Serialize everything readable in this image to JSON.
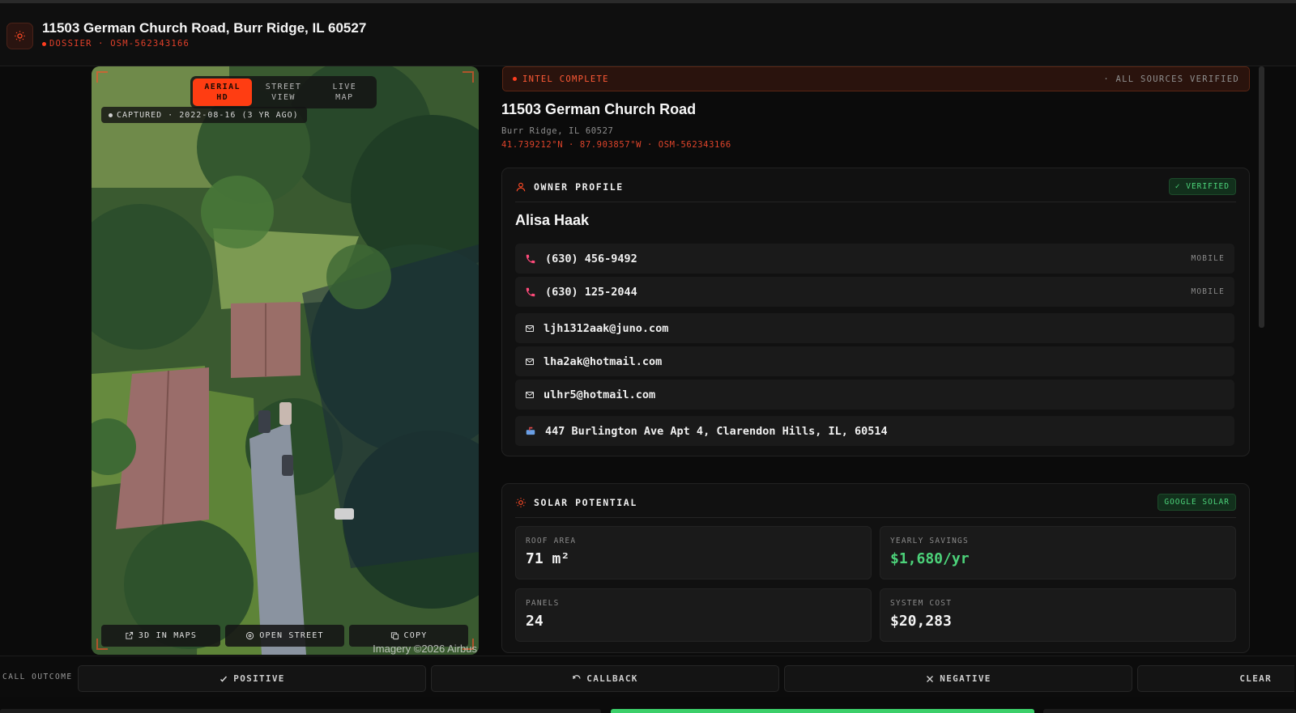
{
  "header": {
    "title": "11503 German Church Road, Burr Ridge, IL 60527",
    "subtitle": "DOSSIER · OSM-562343166",
    "icon": "sun-icon"
  },
  "map": {
    "tabs": [
      {
        "label_line1": "AERIAL",
        "label_line2": "HD",
        "active": true
      },
      {
        "label_line1": "STREET",
        "label_line2": "VIEW",
        "active": false
      },
      {
        "label_line1": "LIVE",
        "label_line2": "MAP",
        "active": false
      }
    ],
    "captured": "CAPTURED · 2022-08-16 (3 YR AGO)",
    "buttons": [
      {
        "label": "3D IN MAPS",
        "icon": "external-link-icon"
      },
      {
        "label": "OPEN STREET",
        "icon": "target-icon"
      },
      {
        "label": "COPY",
        "icon": "copy-icon"
      }
    ],
    "attribution": "Imagery ©2026 Airbus"
  },
  "intel": {
    "status": "INTEL COMPLETE",
    "sources": "· ALL SOURCES VERIFIED"
  },
  "address": {
    "street": "11503 German Church Road",
    "city": "Burr Ridge, IL 60527",
    "coords": "41.739212°N · 87.903857°W · OSM-562343166"
  },
  "owner": {
    "section_title": "OWNER PROFILE",
    "badge": "✓ VERIFIED",
    "name": "Alisa Haak",
    "phones": [
      {
        "number": "(630) 456-9492",
        "type": "MOBILE"
      },
      {
        "number": "(630) 125-2044",
        "type": "MOBILE"
      }
    ],
    "emails": [
      "ljh1312aak@juno.com",
      "lha2ak@hotmail.com",
      "ulhr5@hotmail.com"
    ],
    "mailing_address": "447 Burlington Ave Apt 4, Clarendon Hills, IL, 60514"
  },
  "solar": {
    "section_title": "SOLAR POTENTIAL",
    "badge": "GOOGLE SOLAR",
    "stats": [
      {
        "label": "ROOF AREA",
        "value": "71 m²"
      },
      {
        "label": "YEARLY SAVINGS",
        "value": "$1,680/yr"
      },
      {
        "label": "PANELS",
        "value": "24"
      },
      {
        "label": "SYSTEM COST",
        "value": "$20,283"
      }
    ]
  },
  "outcome": {
    "label": "CALL OUTCOME",
    "buttons": [
      {
        "label": "POSITIVE",
        "icon": "check-icon"
      },
      {
        "label": "CALLBACK",
        "icon": "refresh-icon"
      },
      {
        "label": "NEGATIVE",
        "icon": "x-icon"
      },
      {
        "label": "CLEAR",
        "icon": ""
      }
    ]
  },
  "colors": {
    "accent": "#ff3d12",
    "success": "#4cd37a",
    "background": "#0b0b0b"
  }
}
